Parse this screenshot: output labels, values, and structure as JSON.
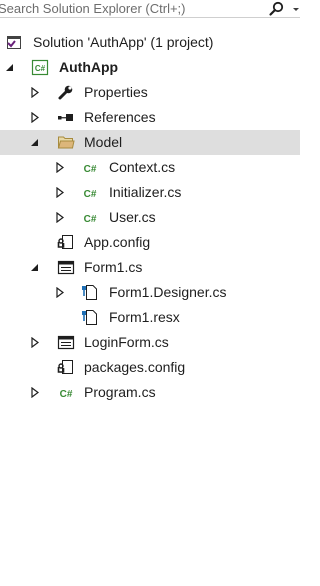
{
  "search": {
    "placeholder": "Search Solution Explorer (Ctrl+;)"
  },
  "tree": {
    "solution": "Solution 'AuthApp' (1 project)",
    "project": "AuthApp",
    "properties": "Properties",
    "references": "References",
    "model": "Model",
    "context": "Context.cs",
    "initializer": "Initializer.cs",
    "user": "User.cs",
    "app_config": "App.config",
    "form1": "Form1.cs",
    "form1_designer": "Form1.Designer.cs",
    "form1_resx": "Form1.resx",
    "loginform": "LoginForm.cs",
    "packages_config": "packages.config",
    "program": "Program.cs"
  },
  "icons": {
    "csharp_glyph": "C#",
    "csharp_color": "#388a34",
    "selection_color": "#dedede"
  }
}
